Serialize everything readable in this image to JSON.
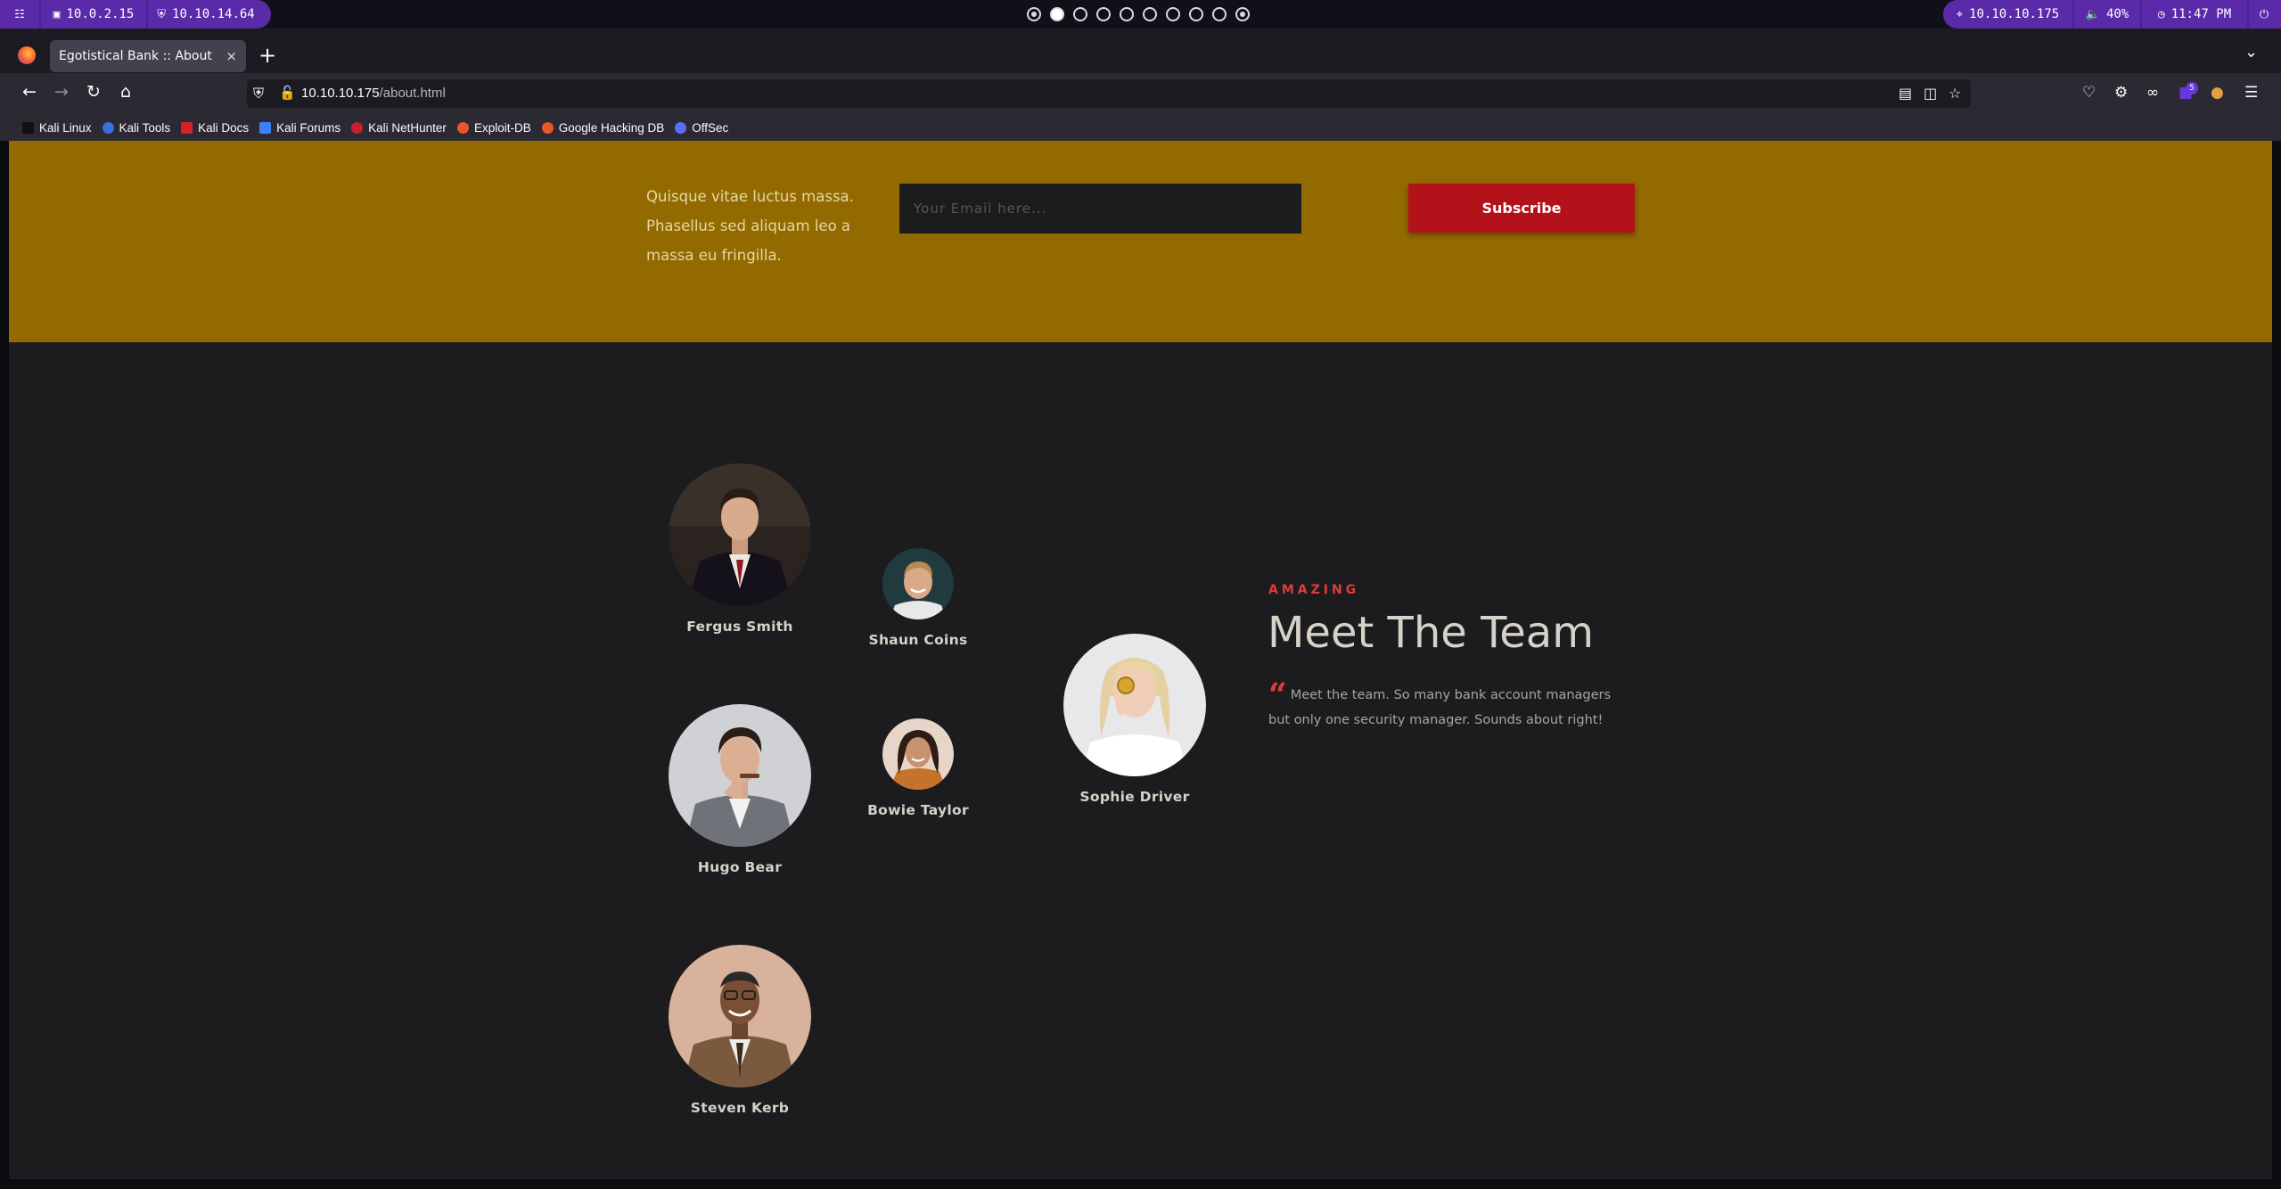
{
  "system_panel": {
    "left_items": [
      {
        "icon": "menu-grid-icon"
      },
      {
        "icon": "monitor-icon",
        "label": "10.0.2.15"
      },
      {
        "icon": "vpn-shield-icon",
        "label": "10.10.14.64"
      }
    ],
    "workspaces": {
      "count": 10,
      "active_index": 1
    },
    "right_items": [
      {
        "icon": "target-icon",
        "label": "10.10.10.175"
      },
      {
        "icon": "volume-icon",
        "label": "40%"
      },
      {
        "icon": "clock-icon",
        "label": "11:47 PM"
      },
      {
        "icon": "power-icon"
      }
    ]
  },
  "browser": {
    "tab": {
      "title": "Egotistical Bank :: About",
      "close": "×"
    },
    "new_tab": "+",
    "url": {
      "host": "10.10.10.175",
      "path": "/about.html"
    },
    "bookmarks": [
      {
        "label": "Kali Linux",
        "color": "#1a1a1a"
      },
      {
        "label": "Kali Tools",
        "color": "#3b6fe0"
      },
      {
        "label": "Kali Docs",
        "color": "#d8202a"
      },
      {
        "label": "Kali Forums",
        "color": "#3b82f6"
      },
      {
        "label": "Kali NetHunter",
        "color": "#c71f2d"
      },
      {
        "label": "Exploit-DB",
        "color": "#e8572a"
      },
      {
        "label": "Google Hacking DB",
        "color": "#e8572a"
      },
      {
        "label": "OffSec",
        "color": "#5b6cf6"
      }
    ]
  },
  "subscribe": {
    "text": "Quisque vitae luctus massa. Phasellus sed aliquam leo a massa eu fringilla.",
    "email_placeholder": "Your Email here...",
    "button_label": "Subscribe",
    "band_color": "#926a00",
    "button_color": "#b3121a"
  },
  "team": {
    "kicker": "AMAZING",
    "title": "Meet The Team",
    "description": "Meet the team. So many bank account managers but only one security manager. Sounds about right!",
    "members": [
      {
        "name": "Fergus Smith"
      },
      {
        "name": "Shaun Coins"
      },
      {
        "name": "Sophie Driver"
      },
      {
        "name": "Hugo Bear"
      },
      {
        "name": "Bowie Taylor"
      },
      {
        "name": "Steven Kerb"
      }
    ]
  }
}
